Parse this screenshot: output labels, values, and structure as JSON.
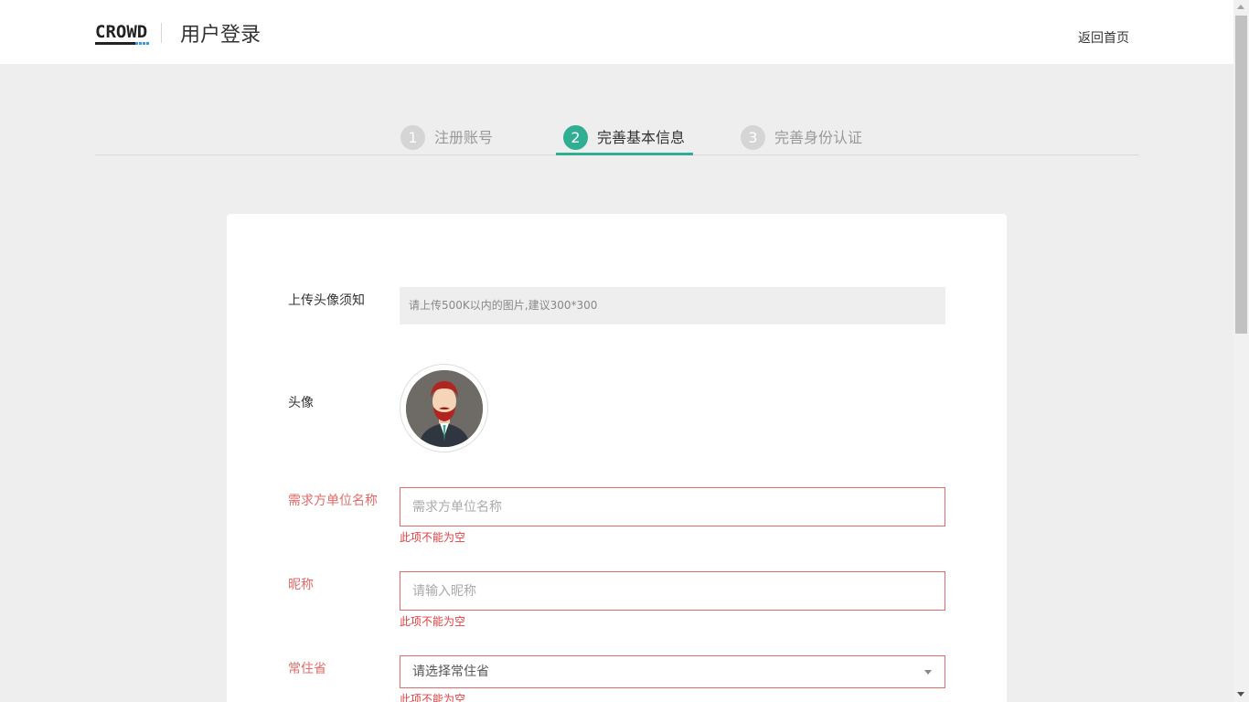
{
  "header": {
    "logo_text": "CROWD",
    "title": "用户登录",
    "back_link": "返回首页"
  },
  "steps": [
    {
      "num": "1",
      "label": "注册账号",
      "active": false
    },
    {
      "num": "2",
      "label": "完善基本信息",
      "active": true
    },
    {
      "num": "3",
      "label": "完善身份认证",
      "active": false
    }
  ],
  "form": {
    "avatar_notice_label": "上传头像须知",
    "avatar_notice_text": "请上传500K以内的图片,建议300*300",
    "avatar_label": "头像",
    "company_label": "需求方单位名称",
    "company_placeholder": "需求方单位名称",
    "company_error": "此项不能为空",
    "nickname_label": "昵称",
    "nickname_placeholder": "请输入昵称",
    "nickname_error": "此项不能为空",
    "province_label": "常住省",
    "province_value": "请选择常住省",
    "province_error": "此项不能为空"
  },
  "colors": {
    "accent": "#2fae93",
    "required": "#e36a6a",
    "error": "#e04040"
  }
}
